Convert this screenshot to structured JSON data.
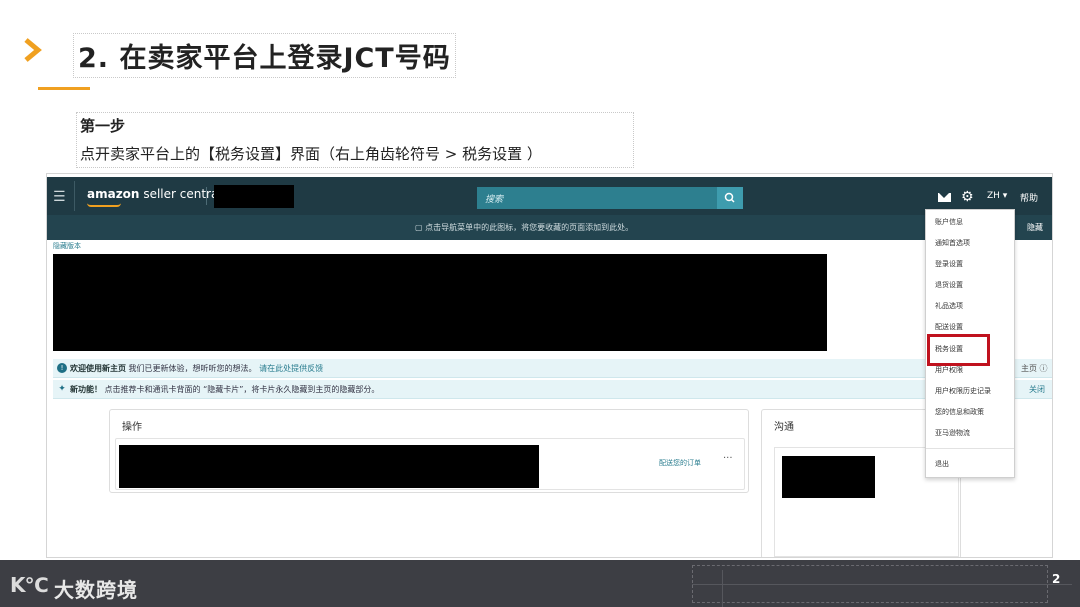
{
  "slide": {
    "title": "2. 在卖家平台上登录JCT号码",
    "step_title": "第一步",
    "step_desc": "点开卖家平台上的【税务设置】界面（右上角齿轮符号 > 税务设置 ）",
    "page_number": "2",
    "footer_brand": "大数跨境",
    "footer_logo": "K℃",
    "accent_color": "#f0a020",
    "footer_color": "#3d3e44"
  },
  "seller_central": {
    "brand_prefix": "amazon",
    "brand_suffix": "seller central",
    "search_placeholder": "搜索",
    "language": "ZH ▾",
    "help": "帮助",
    "nav_hint": "点击导航菜单中的此图标，将您要收藏的页面添加到此处。",
    "nav_hint_right": "隐藏",
    "hidden_link": "隐藏版本",
    "notice1_bold": "欢迎使用新主页",
    "notice1_text": "我们已更新体验，想听听您的想法。",
    "notice1_link": "请在此处提供反馈",
    "notice1_right": "主页 ⓘ",
    "notice2_bold": "新功能！",
    "notice2_text": "点击推荐卡和通讯卡背面的 “隐藏卡片”，将卡片永久隐藏到主页的隐藏部分。",
    "notice2_right": "关闭",
    "card_operations_title": "操作",
    "card_operations_link": "配送您的订单",
    "card_operations_more": "···",
    "card_comm_title": "沟通",
    "theme_color": "#1f3a44",
    "highlight_color": "#c0121e"
  },
  "settings_menu": {
    "items": [
      "账户信息",
      "通知首选项",
      "登录设置",
      "退货设置",
      "礼品选项",
      "配送设置",
      "税务设置",
      "用户权限",
      "用户权限历史记录",
      "您的信息和政策",
      "亚马逊物流",
      "退出"
    ],
    "highlighted": "税务设置"
  }
}
